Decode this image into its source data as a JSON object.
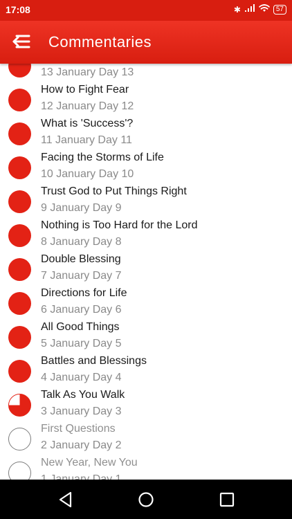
{
  "status_bar": {
    "time": "17:08",
    "battery": "57"
  },
  "app_bar": {
    "title": "Commentaries"
  },
  "colors": {
    "accent": "#e32215",
    "app_bar": "#d81e10"
  },
  "items": [
    {
      "title": "",
      "subtitle": "13 January Day 13",
      "progress": 1.0
    },
    {
      "title": "How to Fight Fear",
      "subtitle": "12 January Day 12",
      "progress": 1.0
    },
    {
      "title": "What is 'Success'?",
      "subtitle": "11 January Day 11",
      "progress": 1.0
    },
    {
      "title": "Facing the Storms of Life",
      "subtitle": "10 January Day 10",
      "progress": 1.0
    },
    {
      "title": "Trust God to Put Things Right",
      "subtitle": "9 January Day 9",
      "progress": 1.0
    },
    {
      "title": "Nothing is Too Hard for the Lord",
      "subtitle": "8 January Day 8",
      "progress": 1.0
    },
    {
      "title": "Double Blessing",
      "subtitle": "7 January Day 7",
      "progress": 1.0
    },
    {
      "title": "Directions for Life",
      "subtitle": "6 January Day 6",
      "progress": 1.0
    },
    {
      "title": "All Good Things",
      "subtitle": "5 January Day 5",
      "progress": 1.0
    },
    {
      "title": "Battles and Blessings",
      "subtitle": "4 January Day 4",
      "progress": 1.0
    },
    {
      "title": "Talk As You Walk",
      "subtitle": "3 January Day 3",
      "progress": 0.75
    },
    {
      "title": "First Questions",
      "subtitle": "2 January Day 2",
      "progress": 0
    },
    {
      "title": "New Year, New You",
      "subtitle": "1 January Day 1",
      "progress": 0
    }
  ],
  "nav_bar": {
    "back": "back-icon",
    "home": "home-icon",
    "recents": "recents-icon"
  }
}
